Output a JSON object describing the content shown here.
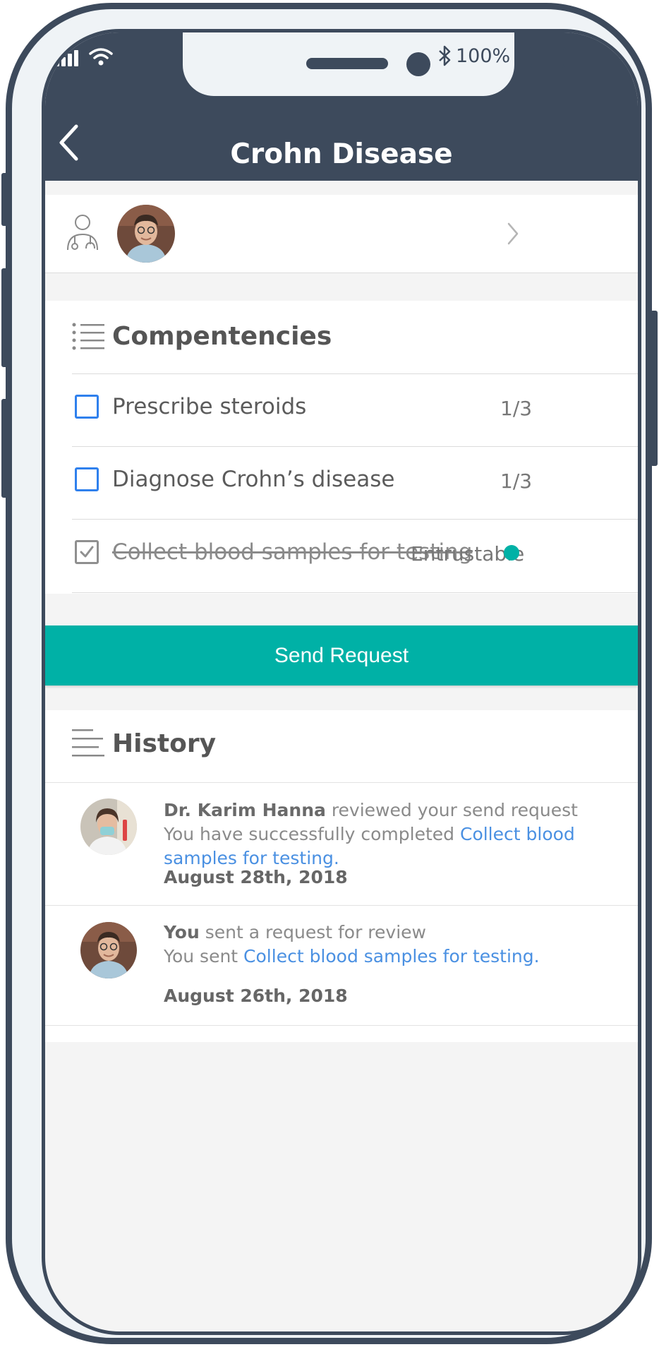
{
  "status_bar": {
    "battery": "100%"
  },
  "header": {
    "title": "Crohn Disease"
  },
  "competencies": {
    "title": "Compentencies",
    "items": [
      {
        "label": "Prescribe steroids",
        "count": "1/3",
        "checked": false
      },
      {
        "label": "Diagnose Crohn’s disease",
        "count": "1/3",
        "checked": false
      },
      {
        "label": "Collect blood samples for testing",
        "status": "Entrustable",
        "checked": true
      }
    ]
  },
  "send_button": {
    "label": "Send Request"
  },
  "history": {
    "title": "History",
    "entries": [
      {
        "actor": "Dr. Karim Hanna",
        "action": " reviewed your send request",
        "line2_prefix": "You have successfully completed ",
        "link": "Collect blood samples for testing.",
        "date": "August 28th, 2018"
      },
      {
        "actor": "You",
        "action": " sent a request for review",
        "line2_prefix": "You sent ",
        "link": "Collect blood samples for testing.",
        "date": "August 26th, 2018"
      }
    ]
  },
  "colors": {
    "frame": "#3d4a5c",
    "accent": "#00b1a6",
    "link": "#4a90e2",
    "checkbox": "#2f80ed"
  }
}
